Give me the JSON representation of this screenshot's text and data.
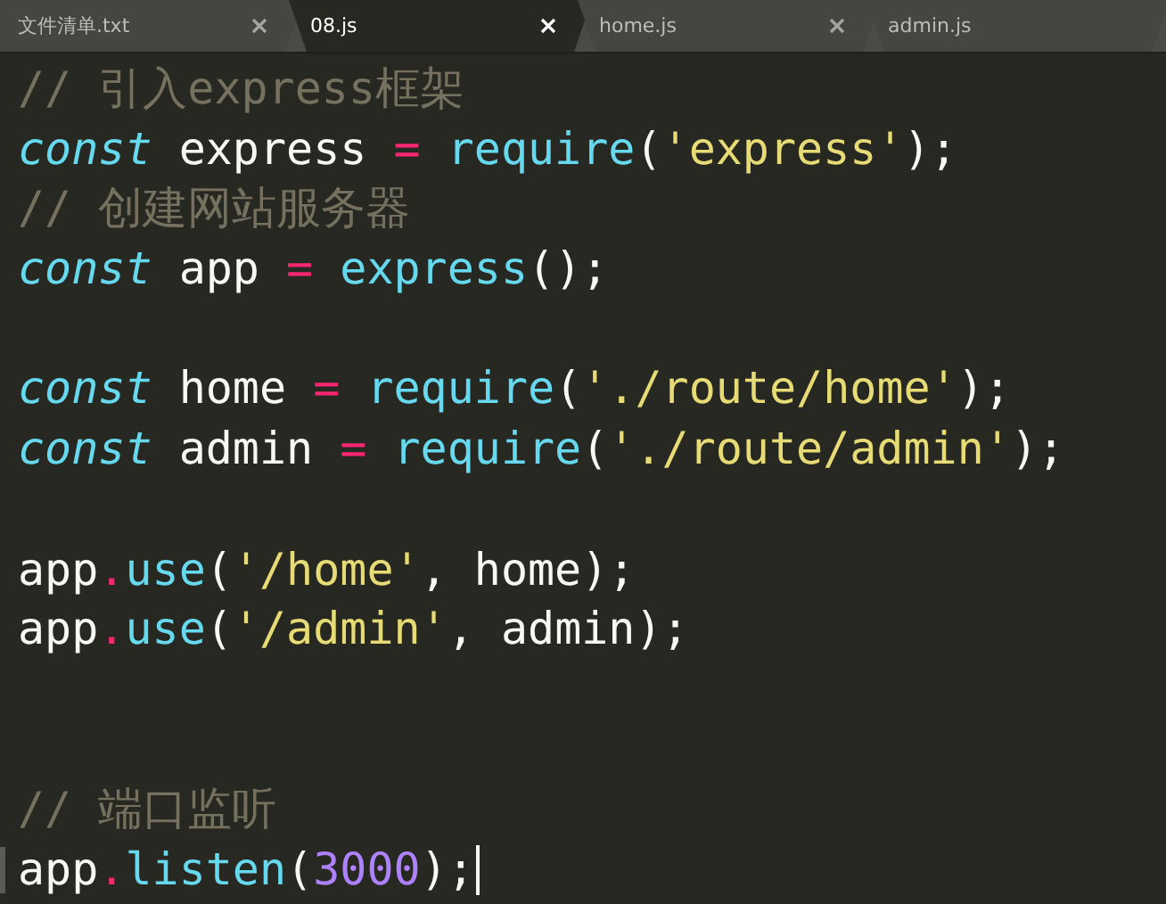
{
  "tabs": [
    {
      "label": "文件清单.txt",
      "selected": false,
      "closable": true
    },
    {
      "label": "08.js",
      "selected": true,
      "closable": true
    },
    {
      "label": "home.js",
      "selected": false,
      "closable": true
    },
    {
      "label": "admin.js",
      "selected": false,
      "closable": false
    }
  ],
  "editor": {
    "lines": [
      {
        "cursor": false,
        "tokens": [
          {
            "kind": "comment",
            "text": "// 引入express框架"
          }
        ]
      },
      {
        "cursor": false,
        "tokens": [
          {
            "kind": "keyword",
            "text": "const"
          },
          {
            "kind": "plain",
            "text": " express "
          },
          {
            "kind": "operator",
            "text": "="
          },
          {
            "kind": "function",
            "text": " require"
          },
          {
            "kind": "plain",
            "text": "("
          },
          {
            "kind": "string",
            "text": "'express'"
          },
          {
            "kind": "plain",
            "text": ");"
          }
        ]
      },
      {
        "cursor": false,
        "tokens": [
          {
            "kind": "comment",
            "text": "// 创建网站服务器"
          }
        ]
      },
      {
        "cursor": false,
        "tokens": [
          {
            "kind": "keyword",
            "text": "const"
          },
          {
            "kind": "plain",
            "text": " app "
          },
          {
            "kind": "operator",
            "text": "="
          },
          {
            "kind": "function",
            "text": " express"
          },
          {
            "kind": "plain",
            "text": "();"
          }
        ]
      },
      {
        "cursor": false
      },
      {
        "cursor": false,
        "tokens": [
          {
            "kind": "keyword",
            "text": "const"
          },
          {
            "kind": "plain",
            "text": " home "
          },
          {
            "kind": "operator",
            "text": "="
          },
          {
            "kind": "function",
            "text": " require"
          },
          {
            "kind": "plain",
            "text": "("
          },
          {
            "kind": "string",
            "text": "'./route/home'"
          },
          {
            "kind": "plain",
            "text": ");"
          }
        ]
      },
      {
        "cursor": false,
        "tokens": [
          {
            "kind": "keyword",
            "text": "const"
          },
          {
            "kind": "plain",
            "text": " admin "
          },
          {
            "kind": "operator",
            "text": "="
          },
          {
            "kind": "function",
            "text": " require"
          },
          {
            "kind": "plain",
            "text": "("
          },
          {
            "kind": "string",
            "text": "'./route/admin'"
          },
          {
            "kind": "plain",
            "text": ");"
          }
        ]
      },
      {
        "cursor": false
      },
      {
        "cursor": false,
        "tokens": [
          {
            "kind": "plain",
            "text": "app"
          },
          {
            "kind": "operator",
            "text": "."
          },
          {
            "kind": "function",
            "text": "use"
          },
          {
            "kind": "plain",
            "text": "("
          },
          {
            "kind": "string",
            "text": "'/home'"
          },
          {
            "kind": "plain",
            "text": ", home);"
          }
        ]
      },
      {
        "cursor": false,
        "tokens": [
          {
            "kind": "plain",
            "text": "app"
          },
          {
            "kind": "operator",
            "text": "."
          },
          {
            "kind": "function",
            "text": "use"
          },
          {
            "kind": "plain",
            "text": "("
          },
          {
            "kind": "string",
            "text": "'/admin'"
          },
          {
            "kind": "plain",
            "text": ", admin);"
          }
        ]
      },
      {
        "cursor": false
      },
      {
        "cursor": false
      },
      {
        "cursor": false,
        "tokens": [
          {
            "kind": "comment",
            "text": "// 端口监听"
          }
        ]
      },
      {
        "cursor": true,
        "tokens": [
          {
            "kind": "plain",
            "text": "app"
          },
          {
            "kind": "operator",
            "text": "."
          },
          {
            "kind": "function",
            "text": "listen"
          },
          {
            "kind": "plain",
            "text": "("
          },
          {
            "kind": "number",
            "text": "3000"
          },
          {
            "kind": "plain",
            "text": ");"
          }
        ]
      }
    ]
  }
}
